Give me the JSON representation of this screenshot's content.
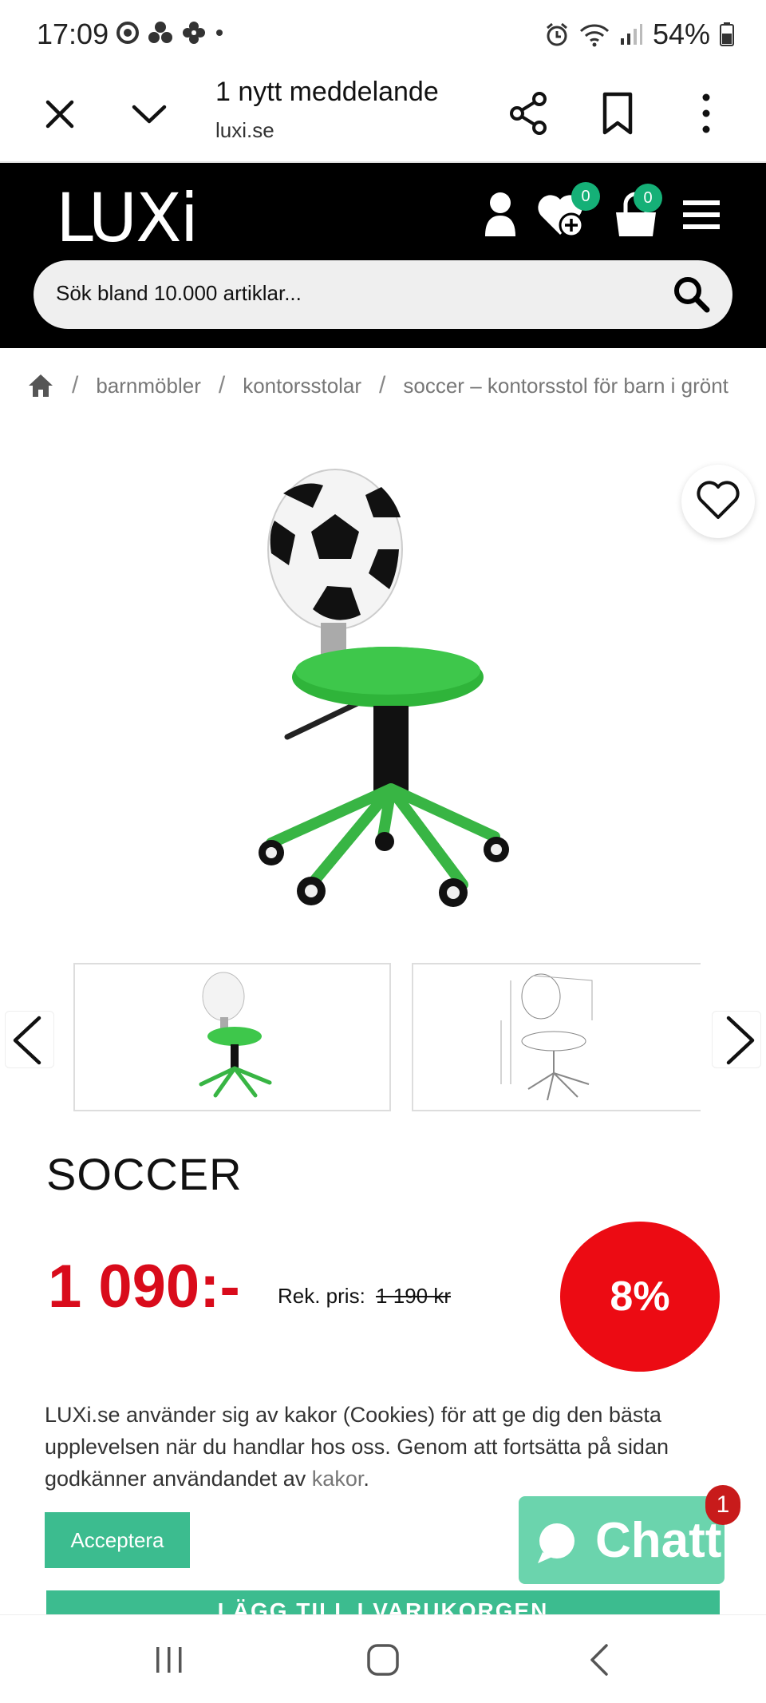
{
  "status_bar": {
    "time": "17:09",
    "battery": "54%"
  },
  "browser": {
    "title": "1 nytt meddelande",
    "url": "luxi.se"
  },
  "header": {
    "logo": "LUXi",
    "wishlist_count": "0",
    "cart_count": "0",
    "search_placeholder": "Sök bland 10.000 artiklar..."
  },
  "breadcrumb": {
    "items": [
      "barnmöbler",
      "kontorsstolar",
      "soccer – kontorsstol för barn i grönt"
    ]
  },
  "product": {
    "name": "SOCCER",
    "price": "1 090:-",
    "rek_label": "Rek. pris:",
    "rek_price": "1 190 kr",
    "discount": "8%"
  },
  "cookie": {
    "text": "LUXi.se använder sig av kakor (Cookies) för att ge dig den bästa upplevelsen när du handlar hos oss. Genom att fortsätta på sidan godkänner användandet av",
    "link": "kakor",
    "end": ".",
    "accept_label": "Acceptera"
  },
  "chat": {
    "label": "Chatt",
    "badge": "1"
  },
  "cart_button": {
    "label": "LÄGG TILL I VARUKORGEN"
  },
  "colors": {
    "price_red": "#d90b1b",
    "discount_red": "#ec0b13",
    "accent_green": "#3cbc8f",
    "chat_green": "#6bd4ad",
    "badge_green": "#15b077"
  }
}
